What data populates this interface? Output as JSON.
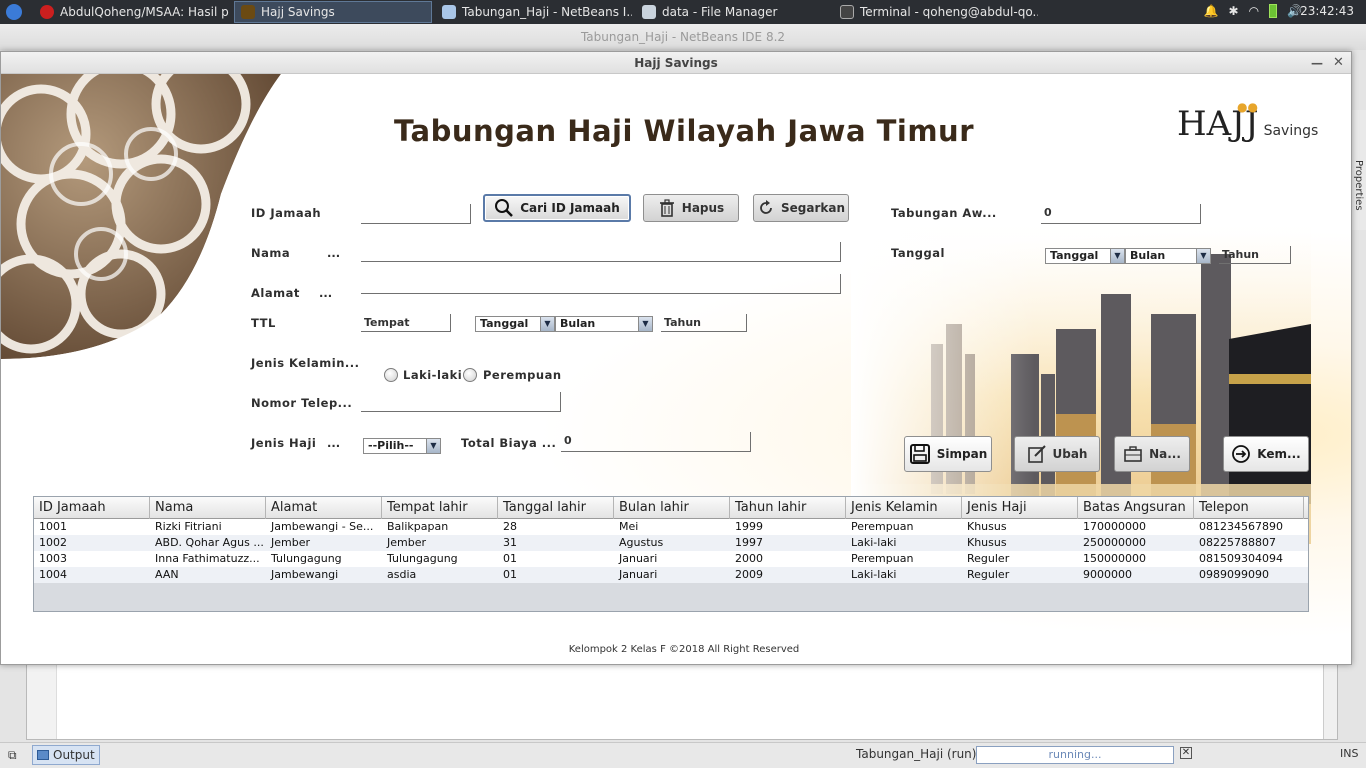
{
  "taskbar": {
    "tasks": [
      {
        "label": "AbdulQoheng/MSAA: Hasil p...",
        "color": "#cc1f1f"
      },
      {
        "label": "Hajj Savings",
        "color": "#6b4a12"
      },
      {
        "label": "Tabungan_Haji - NetBeans I...",
        "color": "#a9c6e8"
      },
      {
        "label": "data - File Manager",
        "color": "#c9d3dd"
      },
      {
        "label": "Terminal - qoheng@abdul-qo...",
        "color": "#444444"
      }
    ],
    "clock": "23:42:43"
  },
  "netbeans": {
    "title": "Tabungan_Haji - NetBeans IDE 8.2",
    "side_tab": "Properties",
    "output_tab": "Output",
    "status_run": "Tabungan_Haji (run)",
    "status_progress": "running...",
    "status_mode": "INS"
  },
  "window": {
    "title": "Hajj Savings"
  },
  "app": {
    "title": "Tabungan Haji Wilayah Jawa Timur",
    "brand_main": "HAJJ",
    "brand_sub": "Savings",
    "footer": "Kelompok 2 Kelas F ©2018 All Right Reserved"
  },
  "form": {
    "id_label": "ID Jamaah",
    "id_value": "",
    "nama_label": "Nama",
    "nama_value": "",
    "alamat_label": "Alamat",
    "alamat_value": "",
    "ttl_label": "TTL",
    "tempat_value": "Tempat",
    "tanggal_combo": "Tanggal",
    "bulan_combo": "Bulan",
    "tahun_value": "Tahun",
    "jk_label": "Jenis Kelamin...",
    "radio_laki": "Laki-laki",
    "radio_perempuan": "Perempuan",
    "telp_label": "Nomor Telep...",
    "telp_value": "",
    "jenis_haji_label": "Jenis Haji",
    "jenis_haji_combo": "--Pilih--",
    "total_biaya_label": "Total Biaya ...",
    "total_biaya_value": "0",
    "tabungan_awal_label": "Tabungan Aw...",
    "tabungan_awal_value": "0",
    "tanggal_label": "Tanggal",
    "tgl2_tanggal_combo": "Tanggal",
    "tgl2_bulan_combo": "Bulan",
    "tgl2_tahun_value": "Tahun",
    "ellipsis": "..."
  },
  "buttons": {
    "cari": "Cari ID Jamaah",
    "hapus": "Hapus",
    "segarkan": "Segarkan",
    "simpan": "Simpan",
    "ubah": "Ubah",
    "nasabah": "Na...",
    "kembali": "Kem..."
  },
  "table": {
    "columns": [
      "ID Jamaah",
      "Nama",
      "Alamat",
      "Tempat lahir",
      "Tanggal lahir",
      "Bulan lahir",
      "Tahun lahir",
      "Jenis Kelamin",
      "Jenis Haji",
      "Batas Angsuran",
      "Telepon"
    ],
    "rows": [
      [
        "1001",
        "Rizki Fitriani",
        "Jambewangi - Se...",
        "Balikpapan",
        "28",
        "Mei",
        "1999",
        "Perempuan",
        "Khusus",
        "170000000",
        "081234567890"
      ],
      [
        "1002",
        "ABD. Qohar Agus ...",
        "Jember",
        "Jember",
        "31",
        "Agustus",
        "1997",
        "Laki-laki",
        "Khusus",
        "250000000",
        "08225788807"
      ],
      [
        "1003",
        "Inna Fathimatuzz...",
        "Tulungagung",
        "Tulungagung",
        "01",
        "Januari",
        "2000",
        "Perempuan",
        "Reguler",
        "150000000",
        "081509304094"
      ],
      [
        "1004",
        "AAN",
        "Jambewangi",
        "asdia",
        "01",
        "Januari",
        "2009",
        "Laki-laki",
        "Reguler",
        "9000000",
        "0989099090"
      ]
    ]
  }
}
